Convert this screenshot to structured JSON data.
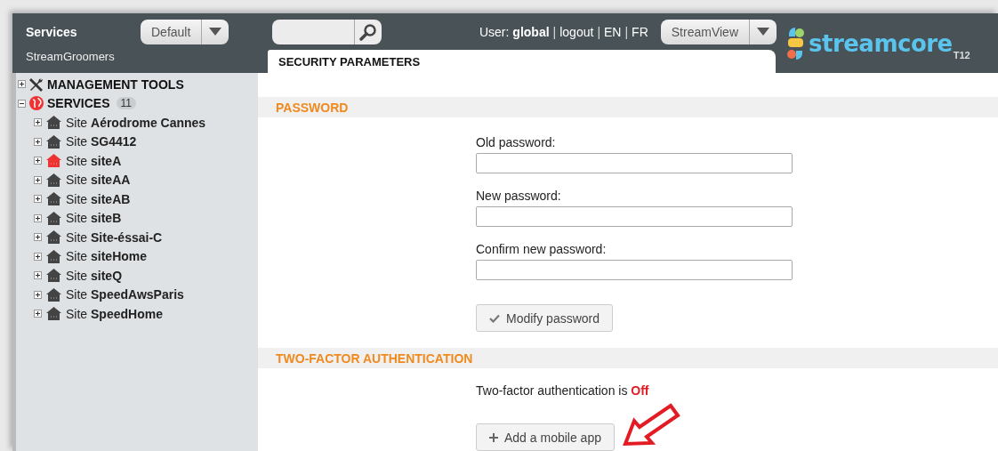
{
  "header": {
    "title": "Services",
    "view_select": {
      "value": "Default"
    },
    "user_label": "User:",
    "user_name": "global",
    "separator": "|",
    "links": [
      "logout",
      "EN",
      "FR"
    ],
    "app_select": {
      "value": "StreamView"
    },
    "logo": {
      "name": "streamcore",
      "suffix": "T12"
    }
  },
  "sidebar": {
    "title": "StreamGroomers",
    "tree": [
      {
        "label": "MANAGEMENT TOOLS",
        "kind": "tools",
        "expanded": false
      },
      {
        "label": "SERVICES",
        "kind": "services",
        "count": "11",
        "expanded": true,
        "children": [
          {
            "prefix": "Site",
            "name": "Aérodrome Cannes",
            "color": "#444444",
            "expanded": false
          },
          {
            "prefix": "Site",
            "name": "SG4412",
            "color": "#444444",
            "expanded": false
          },
          {
            "prefix": "Site",
            "name": "siteA",
            "color": "#ee3333",
            "expanded": false
          },
          {
            "prefix": "Site",
            "name": "siteAA",
            "color": "#444444",
            "expanded": false
          },
          {
            "prefix": "Site",
            "name": "siteAB",
            "color": "#444444",
            "expanded": false
          },
          {
            "prefix": "Site",
            "name": "siteB",
            "color": "#444444",
            "expanded": false
          },
          {
            "prefix": "Site",
            "name": "Site-éssai-C",
            "color": "#444444",
            "expanded": false
          },
          {
            "prefix": "Site",
            "name": "siteHome",
            "color": "#444444",
            "expanded": false
          },
          {
            "prefix": "Site",
            "name": "siteQ",
            "color": "#444444",
            "expanded": false
          },
          {
            "prefix": "Site",
            "name": "SpeedAwsParis",
            "color": "#444444",
            "expanded": false
          },
          {
            "prefix": "Site",
            "name": "SpeedHome",
            "color": "#444444",
            "expanded": false
          }
        ]
      }
    ]
  },
  "tab": {
    "label": "SECURITY PARAMETERS"
  },
  "sections": [
    {
      "title": "PASSWORD",
      "kind": "password",
      "fields": [
        {
          "label": "Old password:"
        },
        {
          "label": "New password:"
        },
        {
          "label": "Confirm new password:"
        }
      ],
      "button": {
        "label": "Modify password"
      }
    },
    {
      "title": "TWO-FACTOR AUTHENTICATION",
      "kind": "twofactor",
      "status_label": "Two-factor authentication is",
      "status": "Off",
      "enabled": false,
      "button": {
        "label": "Add a mobile app"
      }
    }
  ]
}
